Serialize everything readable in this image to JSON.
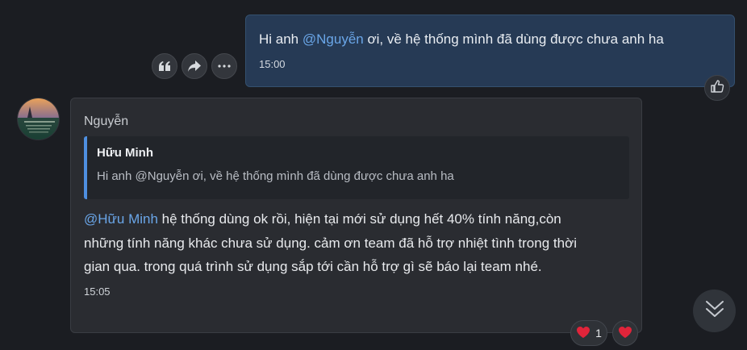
{
  "outgoing": {
    "text_before": "Hi anh ",
    "mention": "@Nguyễn",
    "text_after": " ơi, về hệ thống mình đã dùng được chưa anh ha",
    "time": "15:00"
  },
  "actions": [
    {
      "icon": "quote-icon"
    },
    {
      "icon": "forward-icon"
    },
    {
      "icon": "more-icon"
    }
  ],
  "incoming": {
    "sender": "Nguyễn",
    "quote": {
      "author": "Hữu Minh",
      "text": "Hi anh @Nguyễn ơi, về hệ thống mình đã dùng được chưa anh ha"
    },
    "mention": "@Hữu Minh",
    "text": " hệ thống dùng ok rồi, hiện tại mới sử dụng hết 40% tính năng,còn những tính năng khác chưa sử dụng. cảm ơn team đã hỗ trợ nhiệt tình trong thời gian qua. trong quá trình sử dụng sắp tới cần hỗ trợ gì sẽ báo lại team nhé.",
    "time": "15:05"
  },
  "reactions": [
    {
      "icon": "heart-icon",
      "count": "1"
    },
    {
      "icon": "heart-icon"
    }
  ],
  "colors": {
    "background": "#1b1d22",
    "outgoing_bubble": "#263a55",
    "incoming_bubble": "#2a2c31",
    "mention": "#6aa6e8",
    "quote_bar": "#4e8fe0",
    "heart": "#e0243a"
  }
}
